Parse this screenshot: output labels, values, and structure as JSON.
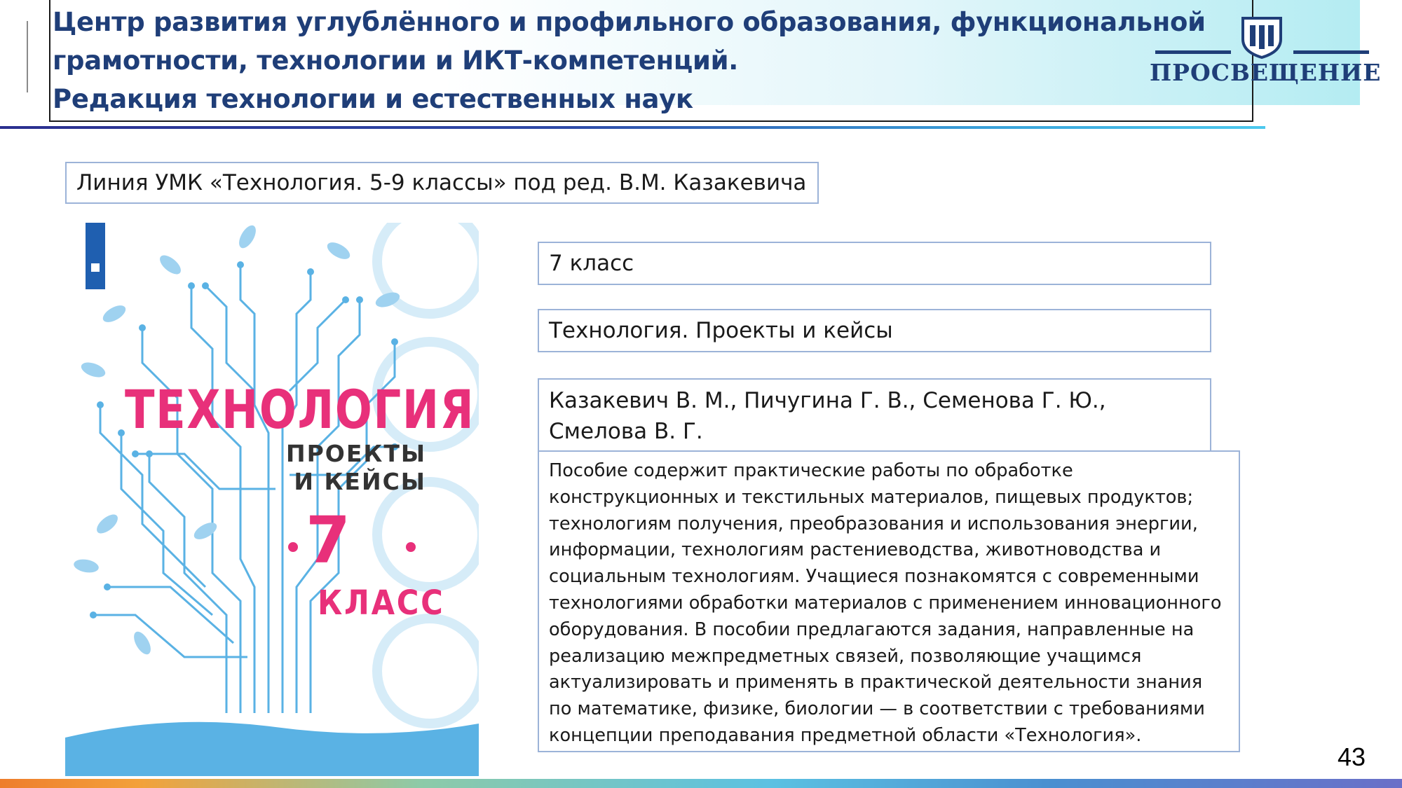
{
  "header": {
    "line1": "Центр развития углублённого и профильного образования, функциональной",
    "line2": "грамотности, технологии и ИКТ-компетенций.",
    "line3": "Редакция технологии и естественных наук",
    "logo_text": "ПРОСВЕЩЕНИЕ",
    "logo_icon": "prosveshchenie-shield-icon"
  },
  "series_label": "Линия УМК «Технология. 5-9 классы» под ред. В.М. Казакевича",
  "book": {
    "grade": "7 класс",
    "title": "Технология. Проекты и кейсы",
    "authors": "Казакевич В. М., Пичугина Г. В., Семенова Г. Ю., Смелова В. Г.",
    "description": "Пособие содержит практические работы по обработке конструкционных и текстильных материалов, пищевых продуктов; технологиям получения, преобразования и использования энергии, информации, технологиям растениеводства, животноводства и социальным технологиям. Учащиеся познакомятся с современными технологиями обработки материалов с применением инновационного оборудования. В пособии предлагаются задания, направленные на реализацию межпредметных связей, позволяющие учащимся актуализировать и применять в практической деятельности знания по математике, физике, биологии — в соответствии с требованиями концепции преподавания предметной области «Технология»."
  },
  "cover": {
    "title": "ТЕХНОЛОГИЯ",
    "subtitle_line1": "ПРОЕКТЫ",
    "subtitle_line2": "И КЕЙСЫ",
    "grade_number": "7",
    "grade_word": "КЛАСС",
    "colors": {
      "pink": "#e8307a",
      "blue": "#5ab2e4",
      "light_blue": "#d6ecf8"
    }
  },
  "page_number": "43"
}
